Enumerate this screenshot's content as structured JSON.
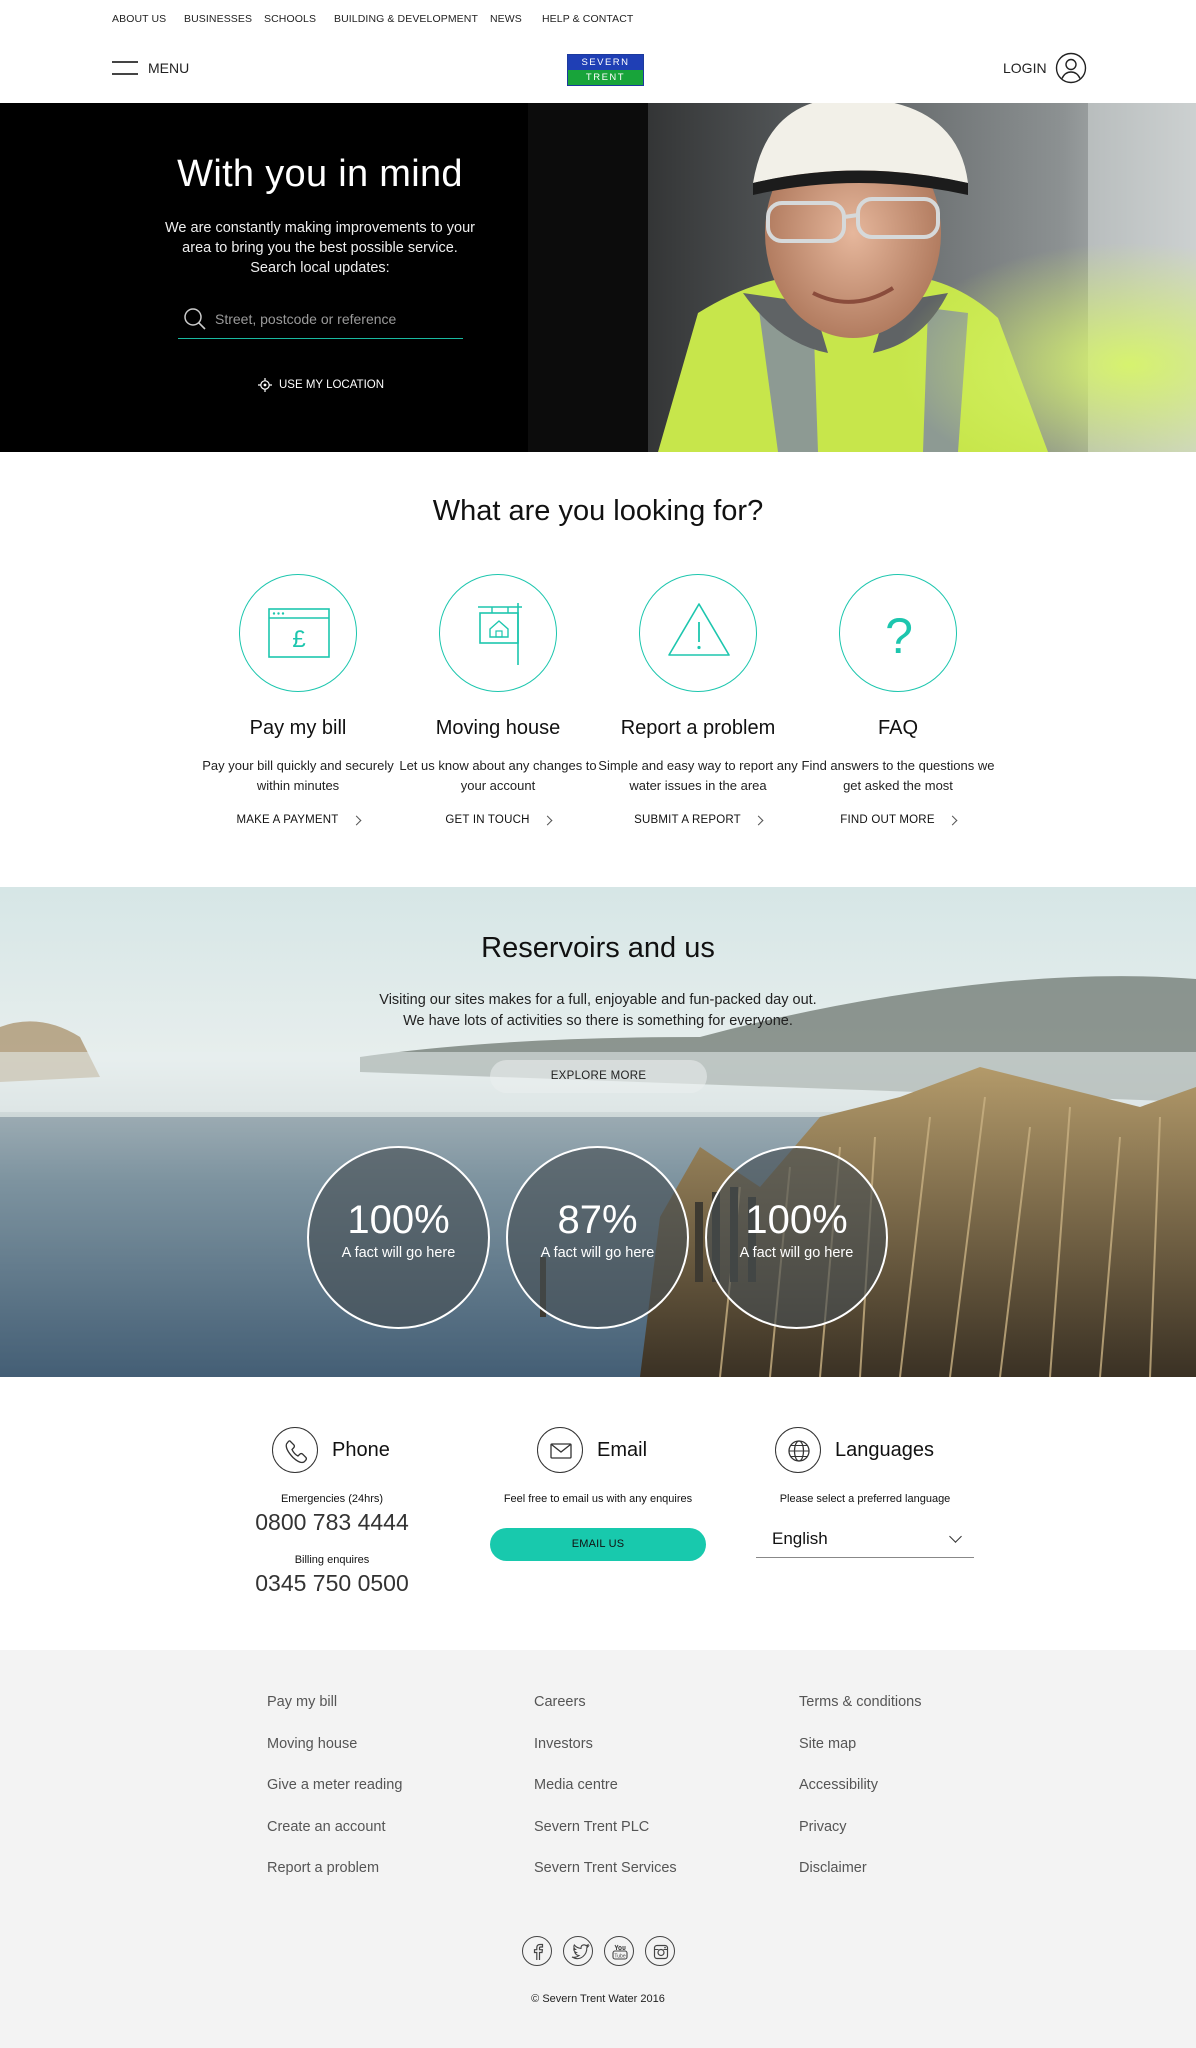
{
  "topnav": {
    "items": [
      "ABOUT US",
      "BUSINESSES",
      "SCHOOLS",
      "BUILDING & DEVELOPMENT",
      "NEWS",
      "HELP & CONTACT"
    ]
  },
  "header": {
    "menu_label": "MENU",
    "logo_line1": "SEVERN",
    "logo_line2": "TRENT",
    "login_label": "LOGIN"
  },
  "hero": {
    "title": "With you in mind",
    "text": "We are constantly making improvements to your area to bring you the best possible service. Search local updates:",
    "search_placeholder": "Street, postcode or reference",
    "use_location": "USE MY LOCATION"
  },
  "looking": {
    "title": "What are you looking for?",
    "cards": [
      {
        "icon": "bill-icon",
        "title": "Pay my bill",
        "desc": "Pay your bill quickly and securely within minutes",
        "link": "MAKE A PAYMENT"
      },
      {
        "icon": "house-sign-icon",
        "title": "Moving house",
        "desc": "Let us know about any changes to your account",
        "link": "GET IN TOUCH"
      },
      {
        "icon": "warning-icon",
        "title": "Report a problem",
        "desc": "Simple and easy way to report any water issues in the area",
        "link": "SUBMIT A REPORT"
      },
      {
        "icon": "question-icon",
        "title": "FAQ",
        "desc": "Find answers to the questions we get asked the most",
        "link": "FIND OUT MORE"
      }
    ]
  },
  "reservoirs": {
    "title": "Reservoirs and us",
    "line1": "Visiting our sites makes for a full, enjoyable and fun-packed day out.",
    "line2": "We have lots of activities so there is something for everyone.",
    "button": "EXPLORE MORE",
    "facts": [
      {
        "value": "100%",
        "label": "A fact will go here"
      },
      {
        "value": "87%",
        "label": "A fact will go here"
      },
      {
        "value": "100%",
        "label": "A fact will go here"
      }
    ]
  },
  "contact": {
    "phone": {
      "title": "Phone",
      "emergency_label": "Emergencies (24hrs)",
      "emergency_number": "0800 783 4444",
      "billing_label": "Billing enquires",
      "billing_number": "0345 750 0500"
    },
    "email": {
      "title": "Email",
      "text": "Feel free to email us with any enquires",
      "button": "EMAIL US"
    },
    "languages": {
      "title": "Languages",
      "text": "Please select a preferred language",
      "selected": "English"
    }
  },
  "footer": {
    "col1": [
      "Pay my bill",
      "Moving house",
      "Give a meter reading",
      "Create an account",
      "Report a problem"
    ],
    "col2": [
      "Careers",
      "Investors",
      "Media centre",
      "Severn Trent PLC",
      "Severn Trent Services"
    ],
    "col3": [
      "Terms & conditions",
      "Site map",
      "Accessibility",
      "Privacy",
      "Disclaimer"
    ],
    "socials": [
      "facebook-icon",
      "twitter-icon",
      "youtube-icon",
      "instagram-icon"
    ],
    "copyright": "© Severn Trent Water 2016"
  },
  "colors": {
    "accent": "#19c6ac",
    "logo_blue": "#1f3fb5",
    "logo_green": "#18a43a",
    "footer_bg": "#f3f3f3"
  }
}
